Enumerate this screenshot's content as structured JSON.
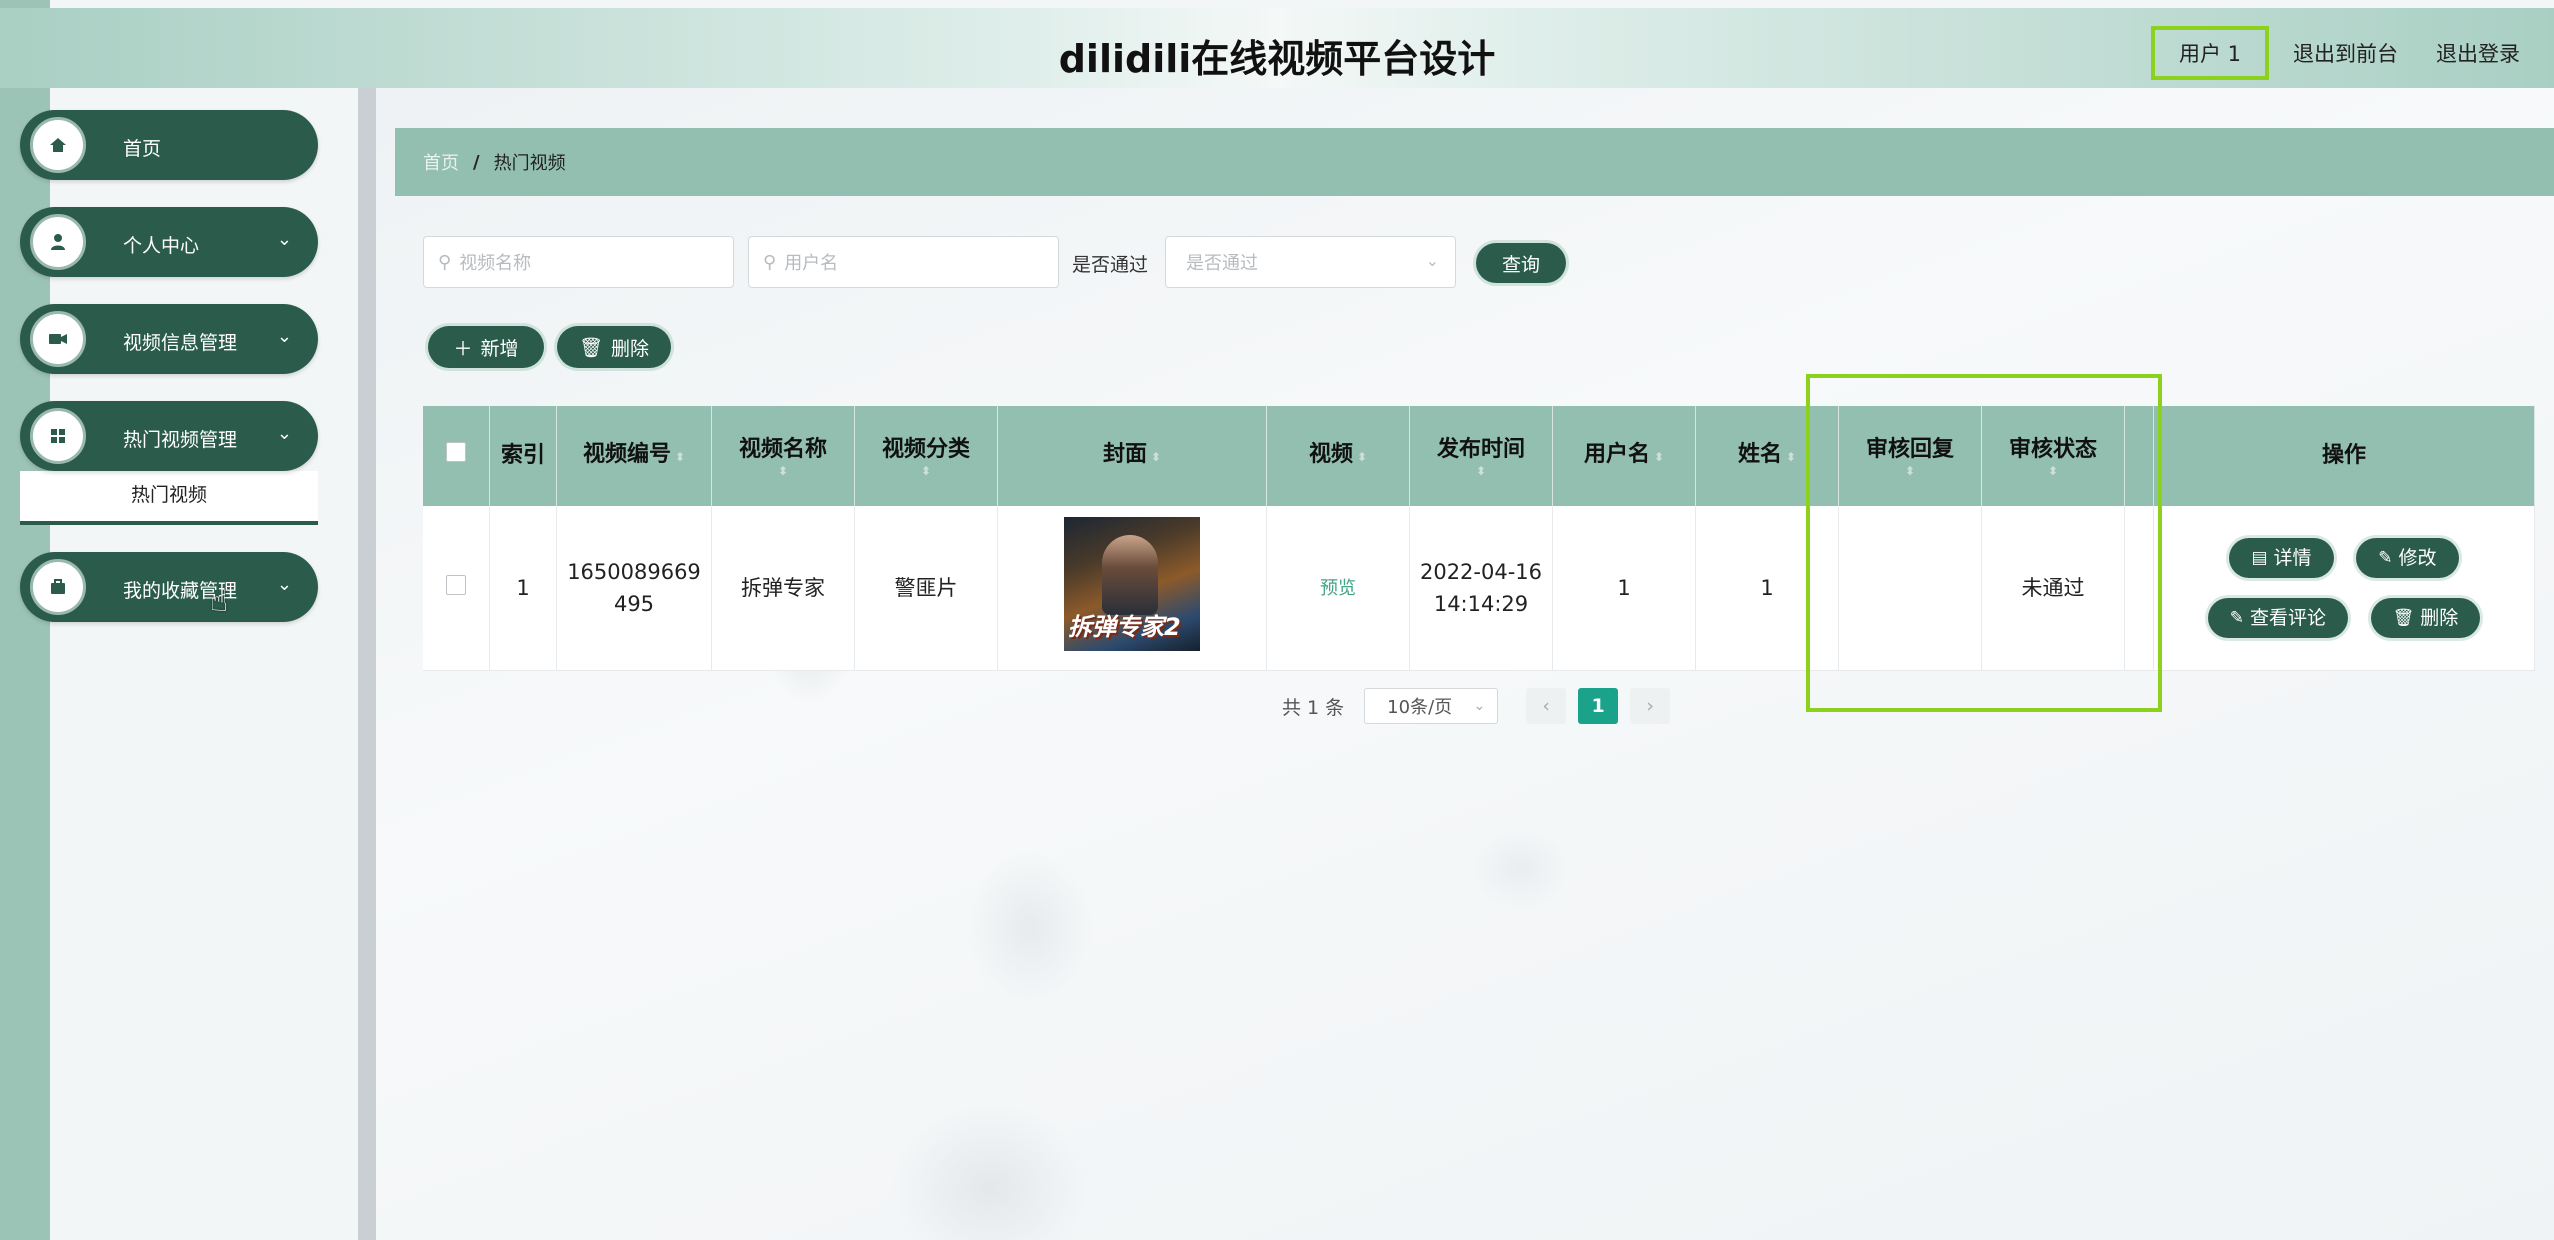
{
  "header": {
    "title": "dilidili在线视频平台设计",
    "user": "用户 1",
    "exit_front": "退出到前台",
    "logout": "退出登录"
  },
  "sidebar": {
    "items": [
      {
        "label": "首页",
        "icon": "home-icon"
      },
      {
        "label": "个人中心",
        "icon": "person-icon"
      },
      {
        "label": "视频信息管理",
        "icon": "video-icon"
      },
      {
        "label": "热门视频管理",
        "icon": "grid-icon"
      },
      {
        "label": "我的收藏管理",
        "icon": "briefcase-icon"
      }
    ],
    "submenu_label": "热门视频"
  },
  "breadcrumb": {
    "home": "首页",
    "separator": "/",
    "current": "热门视频"
  },
  "filters": {
    "video_name_placeholder": "视频名称",
    "username_placeholder": "用户名",
    "passed_label": "是否通过",
    "passed_placeholder": "是否通过",
    "query_button": "查询",
    "add_button": "新增",
    "delete_button": "删除"
  },
  "table": {
    "headers": {
      "index": "索引",
      "video_no": "视频编号",
      "video_name": "视频名称",
      "category": "视频分类",
      "cover": "封面",
      "video": "视频",
      "publish_time": "发布时间",
      "username": "用户名",
      "name": "姓名",
      "review_reply": "审核回复",
      "review_status": "审核状态",
      "actions": "操作"
    },
    "rows": [
      {
        "index": "1",
        "video_no": "1650089669495",
        "video_name": "拆弹专家",
        "category": "警匪片",
        "cover_title": "拆弹专家2",
        "video_link": "预览",
        "publish_time": "2022-04-16 14:14:29",
        "username": "1",
        "name": "1",
        "review_reply": "",
        "review_status": "未通过"
      }
    ],
    "actions": {
      "detail": "详情",
      "edit": "修改",
      "comments": "查看评论",
      "delete": "删除"
    }
  },
  "pagination": {
    "total": "共 1 条",
    "page_size": "10条/页",
    "current_page": "1"
  },
  "colors": {
    "primary": "#2b5c4b",
    "header_bg": "#93bfb0",
    "highlight": "#8cd11d",
    "active_page": "#1aa38a"
  }
}
